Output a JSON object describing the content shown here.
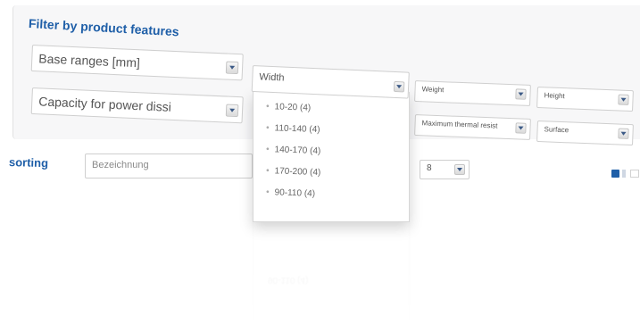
{
  "filter": {
    "title": "Filter by product features",
    "base_ranges": {
      "value": "Base ranges [mm]"
    },
    "capacity": {
      "value": "Capacity for power dissi"
    },
    "width": {
      "value": "Width",
      "options": [
        "10-20 (4)",
        "110-140 (4)",
        "140-170 (4)",
        "170-200 (4)",
        "90-110 (4)"
      ]
    },
    "weight": {
      "value": "Weight"
    },
    "height": {
      "value": "Height"
    },
    "thermal": {
      "value": "Maximum thermal resist"
    },
    "surface": {
      "value": "Surface"
    }
  },
  "sorting": {
    "label": "sorting",
    "value": "Bezeichnung",
    "per_page": "8"
  },
  "reflection": {
    "text": "90-110 (4)"
  },
  "colors": {
    "accent": "#1f5fa8"
  }
}
